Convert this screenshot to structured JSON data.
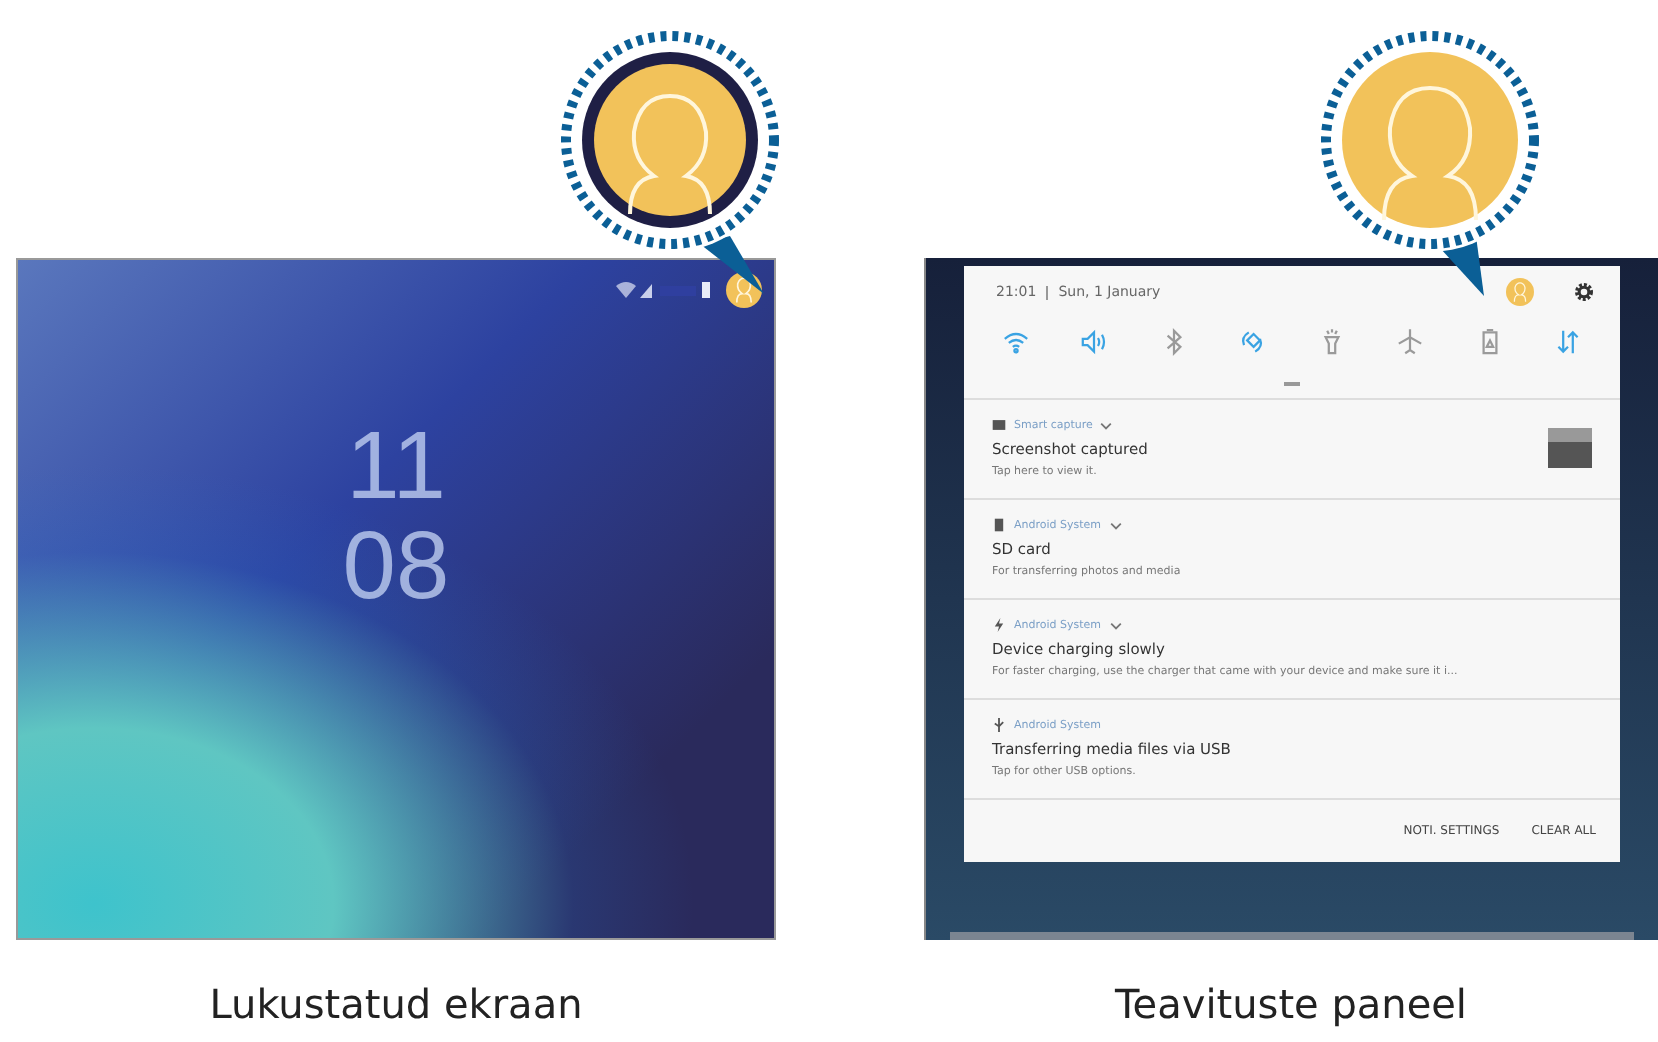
{
  "lock_screen": {
    "clock_hour": "11",
    "clock_minute": "08",
    "caption": "Lukustatud ekraan"
  },
  "notification_panel": {
    "time": "21:01",
    "date": "Sun, 1 January",
    "quick_settings": [
      {
        "kind": "wifi",
        "on": true
      },
      {
        "kind": "sound",
        "on": true
      },
      {
        "kind": "bluetooth",
        "on": false
      },
      {
        "kind": "rotate",
        "on": true
      },
      {
        "kind": "flashlight",
        "on": false
      },
      {
        "kind": "airplane",
        "on": false
      },
      {
        "kind": "battery",
        "on": false
      },
      {
        "kind": "data",
        "on": true
      }
    ],
    "notifications": [
      {
        "kind": "image",
        "app": "Smart capture",
        "expandable": true,
        "title": "Screenshot captured",
        "text": "Tap here to view it.",
        "thumbnail": true
      },
      {
        "kind": "sdcard",
        "app": "Android System",
        "expandable": true,
        "title": "SD card",
        "text": "For transferring photos and media",
        "thumbnail": false
      },
      {
        "kind": "charge",
        "app": "Android System",
        "expandable": true,
        "title": "Device charging slowly",
        "text": "For faster charging, use the charger that came with your device and make sure it i...",
        "thumbnail": false
      },
      {
        "kind": "usb",
        "app": "Android System",
        "expandable": false,
        "title": "Transferring media files via USB",
        "text": "Tap for other USB options.",
        "thumbnail": false
      }
    ],
    "buttons": [
      "NOTI. SETTINGS",
      "CLEAR ALL"
    ],
    "caption": "Teavituste paneel"
  }
}
